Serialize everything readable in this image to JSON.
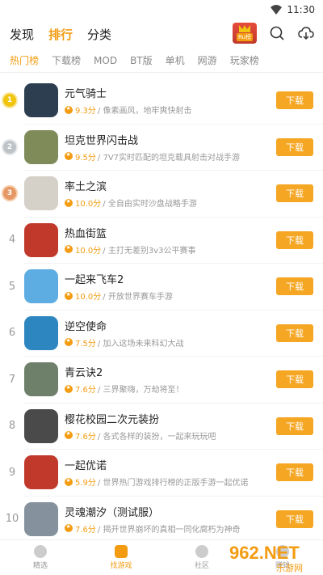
{
  "status": {
    "time": "11:30"
  },
  "header": {
    "tabs": [
      "发现",
      "排行",
      "分类"
    ],
    "active_tab": 1,
    "rank_badge_label": "Ru榜",
    "icons": [
      "search-icon",
      "download-cloud-icon"
    ]
  },
  "subtabs": [
    "热门榜",
    "下载榜",
    "MOD",
    "BT版",
    "单机",
    "网游",
    "玩家榜"
  ],
  "list": [
    {
      "rank": "1",
      "name": "元气骑士",
      "score": "9.3分",
      "desc": " / 像素画风，地牢爽快射击",
      "button": "下载",
      "color": "#2c3e50"
    },
    {
      "rank": "2",
      "name": "坦克世界闪击战",
      "score": "9.5分",
      "desc": " / 7V7实时匹配的坦克载具射击对战手游",
      "button": "下载",
      "color": "#7f8c5a"
    },
    {
      "rank": "3",
      "name": "率土之滨",
      "score": "10.0分",
      "desc": " / 全自由实时沙盘战略手游",
      "button": "下载",
      "color": "#d5d0c8"
    },
    {
      "rank": "4",
      "name": "热血街篮",
      "score": "10.0分",
      "desc": " / 主打无差别3v3公平赛事",
      "button": "下载",
      "color": "#c0392b"
    },
    {
      "rank": "5",
      "name": "一起来飞车2",
      "score": "10.0分",
      "desc": " / 开放世界赛车手游",
      "button": "下载",
      "color": "#5dade2"
    },
    {
      "rank": "6",
      "name": "逆空使命",
      "score": "7.5分",
      "desc": " / 加入这场未来科幻大战",
      "button": "下载",
      "color": "#2e86c1"
    },
    {
      "rank": "7",
      "name": "青云诀2",
      "score": "7.6分",
      "desc": " / 三界聚嗨，万劫将至！",
      "button": "下载",
      "color": "#6e7f6a"
    },
    {
      "rank": "8",
      "name": "樱花校园二次元装扮",
      "score": "7.6分",
      "desc": " / 各式各样的装扮，一起来玩玩吧",
      "button": "下载",
      "color": "#4a4a4a"
    },
    {
      "rank": "9",
      "name": "一起优诺",
      "score": "5.9分",
      "desc": " / 世界热门游戏排行榜的正版手游一起优诺",
      "button": "下载",
      "color": "#c0392b"
    },
    {
      "rank": "10",
      "name": "灵魂潮汐（测试服）",
      "score": "7.6分",
      "desc": " / 揭开世界崩坏的真相一同化腐朽为神奇",
      "button": "下载",
      "color": "#85929e"
    }
  ],
  "bottom_nav": [
    {
      "label": "精选",
      "active": false
    },
    {
      "label": "找游戏",
      "active": true
    },
    {
      "label": "社区",
      "active": false
    },
    {
      "label": "赚钱",
      "active": false
    }
  ],
  "watermark": {
    "main": "962.NET",
    "sub": "乐游网"
  },
  "colors": {
    "accent": "#f39c12",
    "button": "#f5a623"
  }
}
